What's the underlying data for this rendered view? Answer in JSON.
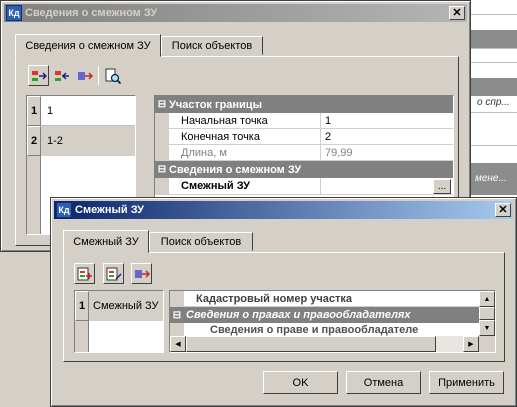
{
  "background_window": {
    "fragments": [
      "о спр...",
      "мене..."
    ]
  },
  "dialog1": {
    "title": "Сведения о смежном ЗУ",
    "close": "✕",
    "tabs": [
      "Сведения о смежном ЗУ",
      "Поиск объектов"
    ],
    "list": [
      {
        "num": "1",
        "label": "1"
      },
      {
        "num": "2",
        "label": "1-2"
      }
    ],
    "props": {
      "group1": {
        "expander": "⊟",
        "title": "Участок границы"
      },
      "rows": [
        {
          "label": "Начальная точка",
          "value": "1"
        },
        {
          "label": "Конечная точка",
          "value": "2"
        },
        {
          "label": "Длина, м",
          "value": "79,99"
        }
      ],
      "group2": {
        "expander": "⊟",
        "title": "Сведения о смежном ЗУ"
      },
      "smezhny": {
        "label": "Смежный ЗУ",
        "ellipsis": "..."
      }
    }
  },
  "dialog2": {
    "title": "Смежный ЗУ",
    "close": "✕",
    "tabs": [
      "Смежный ЗУ",
      "Поиск объектов"
    ],
    "list": [
      {
        "num": "1",
        "label": "Смежный ЗУ"
      }
    ],
    "props": {
      "cadastral_label": "Кадастровый номер участка",
      "group": {
        "expander": "⊟",
        "title": "Сведения о правах и правообладателях"
      },
      "subrow": "Сведения о праве и правообладателе"
    },
    "buttons": {
      "ok": "OK",
      "cancel": "Отмена",
      "apply": "Применить"
    }
  },
  "app_icon_text": "Кд"
}
